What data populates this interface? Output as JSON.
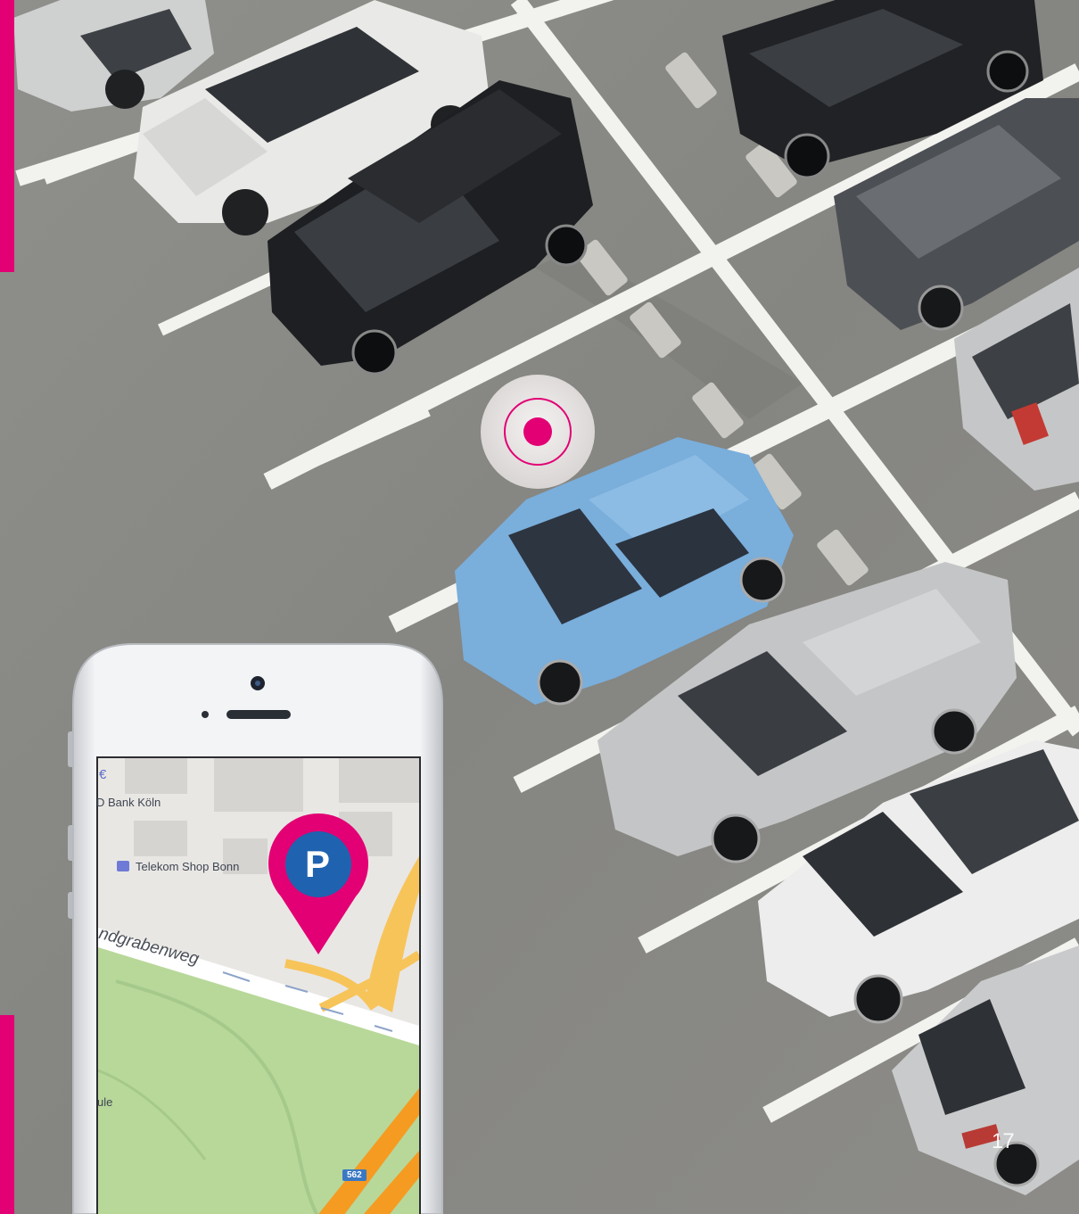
{
  "page_number": "17",
  "colors": {
    "accent": "#e20074",
    "asphalt": "#8a8a86",
    "marking": "#f2f2ef",
    "park": "#b8d89a",
    "road": "#f5b53f",
    "pin_inner": "#1f62b0"
  },
  "phone": {
    "map": {
      "poi_bank": "D Bank Köln",
      "poi_euro": "€",
      "poi_shop": "Telekom Shop Bonn",
      "street": "ndgrabenweg",
      "poi_partial": "ule",
      "route_shield": "562"
    },
    "parking_pin_letter": "P"
  },
  "icons": {
    "location_target": "location-target-icon",
    "parking_pin": "parking-pin-icon",
    "shop": "shopping-bag-icon"
  }
}
